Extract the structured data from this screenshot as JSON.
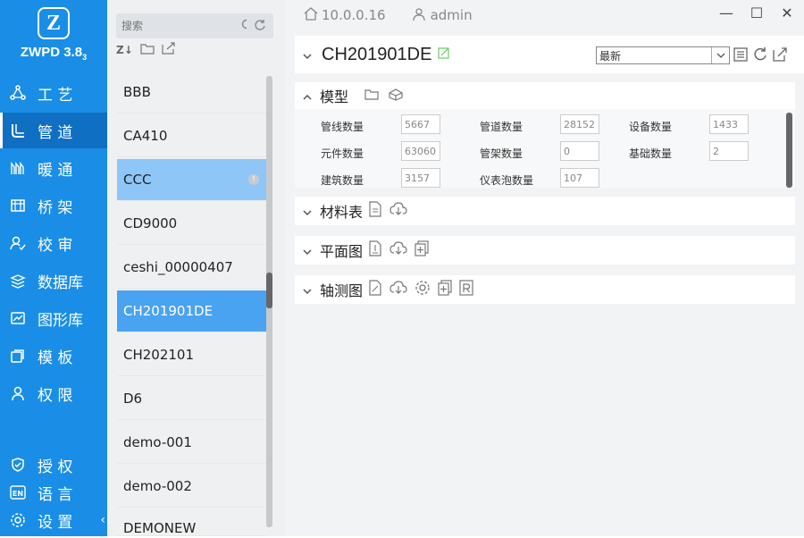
{
  "app": {
    "logo_letter": "Z",
    "name": "ZWPD 3.8",
    "version_sub": "3"
  },
  "nav": [
    {
      "label": "工 艺",
      "icon": "process-icon"
    },
    {
      "label": "管 道",
      "icon": "pipe-icon",
      "active": true
    },
    {
      "label": "暖 通",
      "icon": "hvac-icon"
    },
    {
      "label": "桥 架",
      "icon": "tray-icon"
    },
    {
      "label": "校 审",
      "icon": "review-icon"
    },
    {
      "label": "数据库",
      "icon": "database-icon"
    },
    {
      "label": "图形库",
      "icon": "graphics-icon"
    },
    {
      "label": "模 板",
      "icon": "template-icon"
    },
    {
      "label": "权 限",
      "icon": "user-icon"
    }
  ],
  "nav_bottom": [
    {
      "label": "授 权",
      "icon": "shield-icon"
    },
    {
      "label": "语 言",
      "icon": "language-icon"
    },
    {
      "label": "设 置",
      "icon": "gear-icon"
    }
  ],
  "collapse": "‹",
  "search": {
    "placeholder": "搜索"
  },
  "list_tools": {
    "sort_label": "Z↓"
  },
  "projects": [
    {
      "name": "BBB"
    },
    {
      "name": "CA410"
    },
    {
      "name": "CCC",
      "badge": "!"
    },
    {
      "name": "CD9000"
    },
    {
      "name": "ceshi_00000407"
    },
    {
      "name": "CH201901DE"
    },
    {
      "name": "CH202101"
    },
    {
      "name": "D6"
    },
    {
      "name": "demo-001"
    },
    {
      "name": "demo-002"
    },
    {
      "name": "DEMONEW"
    }
  ],
  "topbar": {
    "server": "10.0.0.16",
    "user": "admin"
  },
  "window_controls": {
    "minimize": "—",
    "maximize": "☐",
    "close": "✕"
  },
  "project_title": "CH201901DE",
  "version_select": {
    "value": "最新"
  },
  "sections": {
    "model": "模型",
    "materials": "材料表",
    "plan": "平面图",
    "iso": "轴测图"
  },
  "stats": [
    {
      "label": "管线数量",
      "value": "5667"
    },
    {
      "label": "管道数量",
      "value": "28152"
    },
    {
      "label": "设备数量",
      "value": "1433"
    },
    {
      "label": "元件数量",
      "value": "63060"
    },
    {
      "label": "管架数量",
      "value": "0"
    },
    {
      "label": "基础数量",
      "value": "2"
    },
    {
      "label": "建筑数量",
      "value": "3157"
    },
    {
      "label": "仪表泡数量",
      "value": "107"
    }
  ],
  "colors": {
    "sidebar": "#1a8ee6",
    "selected_dark": "#4aa3f0",
    "selected_light": "#8ec6f7"
  }
}
